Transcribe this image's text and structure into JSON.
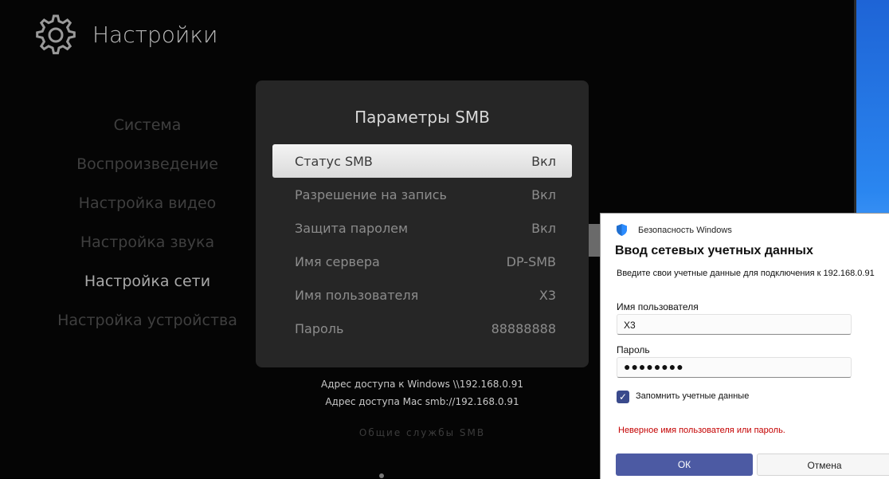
{
  "tv": {
    "header_title": "Настройки",
    "menu": [
      "Система",
      "Воспроизведение",
      "Настройка видео",
      "Настройка звука",
      "Настройка сети",
      "Настройка устройства"
    ],
    "active_index": 4
  },
  "smb_dialog": {
    "title": "Параметры SMB",
    "rows": [
      {
        "label": "Статус SMB",
        "value": "Вкл"
      },
      {
        "label": "Разрешение на запись",
        "value": "Вкл"
      },
      {
        "label": "Защита паролем",
        "value": "Вкл"
      },
      {
        "label": "Имя сервера",
        "value": "DP-SMB"
      },
      {
        "label": "Имя пользователя",
        "value": "X3"
      },
      {
        "label": "Пароль",
        "value": "88888888"
      }
    ],
    "selected_index": 0
  },
  "access": {
    "windows": "Адрес доступа к Windows \\\\192.168.0.91",
    "mac": "Адрес доступа Mac smb://192.168.0.91",
    "footer": "Общие службы SMB"
  },
  "win_dialog": {
    "app": "Безопасность Windows",
    "title": "Ввод сетевых учетных данных",
    "description": "Введите свои учетные данные для подключения к 192.168.0.91",
    "username_label": "Имя пользователя",
    "username_value": "X3",
    "password_label": "Пароль",
    "password_value": "●●●●●●●●",
    "remember_label": "Запомнить учетные данные",
    "remember_checked": true,
    "error": "Неверное имя пользователя или пароль.",
    "ok": "ОК",
    "cancel": "Отмена"
  },
  "colors": {
    "accent": "#4c5aa3",
    "error": "#c40000",
    "desktop": "#2a86f0"
  }
}
